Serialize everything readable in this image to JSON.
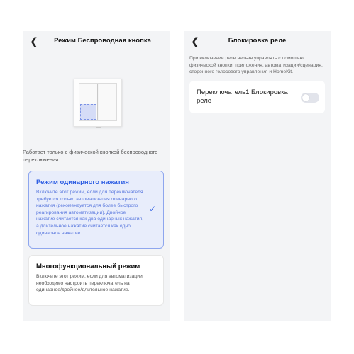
{
  "left_screen": {
    "back_icon": "chevron-left-icon",
    "title": "Режим Беспроводная кнопка",
    "hint": "Работает только с физической кнопкой беспроводного переключения",
    "modes": [
      {
        "title": "Режим одинарного нажатия",
        "description": "Включите этот режим, если для переключателя требуется только автоматизация одинарного нажатия (рекомендуется для более быстрого реагирования автоматизации). Двойное нажатие считается как два одинарных нажатия, а длительное нажатие считается как одно одинарное нажатие.",
        "selected": true,
        "check_icon": "checkmark-icon"
      },
      {
        "title": "Многофункциональный режим",
        "description": "Включите этот режим, если для автоматизации необходимо настроить переключатель на одинарное/двойное/длительное нажатие.",
        "selected": false
      }
    ]
  },
  "right_screen": {
    "back_icon": "chevron-left-icon",
    "title": "Блокировка реле",
    "info": "При включении реле нельзя управлять с помощью физической кнопки, приложения, автоматизации/сценария, стороннего голосового управления и HomeKit.",
    "lock_label": "Переключатель1 Блокировка реле",
    "lock_enabled": false
  },
  "colors": {
    "accent": "#2f5fe3",
    "selected_bg": "#e8edfb",
    "screen_bg": "#f3f4f6",
    "toggle_off": "#e2e4eb"
  }
}
